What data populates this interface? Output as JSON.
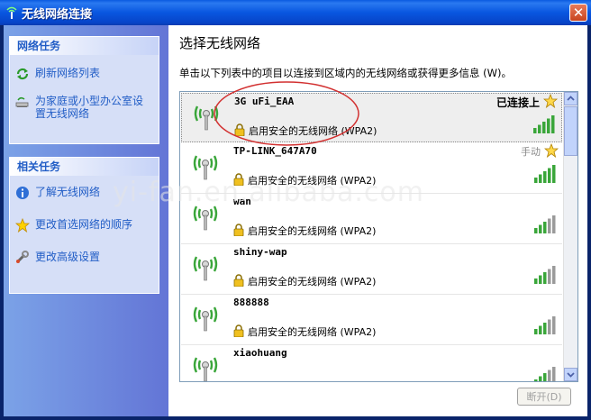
{
  "window": {
    "title": "无线网络连接"
  },
  "sidebar": {
    "network_tasks": {
      "header": "网络任务",
      "items": [
        {
          "label": "刷新网络列表",
          "icon": "refresh-icon"
        },
        {
          "label": "为家庭或小型办公室设置无线网络",
          "icon": "wireless-setup-icon"
        }
      ]
    },
    "related_tasks": {
      "header": "相关任务",
      "items": [
        {
          "label": "了解无线网络",
          "icon": "info-icon"
        },
        {
          "label": "更改首选网络的顺序",
          "icon": "star-icon"
        },
        {
          "label": "更改高级设置",
          "icon": "settings-icon"
        }
      ]
    }
  },
  "main": {
    "title": "选择无线网络",
    "description": "单击以下列表中的项目以连接到区域内的无线网络或获得更多信息 (W)。",
    "networks": [
      {
        "ssid": "3G uFi_EAA",
        "security": "启用安全的无线网络 (WPA2)",
        "status": "已连接上",
        "starred": true,
        "signal": 5
      },
      {
        "ssid": "TP-LINK_647A70",
        "security": "启用安全的无线网络 (WPA2)",
        "status": "手动",
        "starred": true,
        "signal": 5
      },
      {
        "ssid": "wan",
        "security": "启用安全的无线网络 (WPA2)",
        "status": "",
        "starred": false,
        "signal": 3
      },
      {
        "ssid": "shiny-wap",
        "security": "启用安全的无线网络 (WPA2)",
        "status": "",
        "starred": false,
        "signal": 3
      },
      {
        "ssid": "888888",
        "security": "启用安全的无线网络 (WPA2)",
        "status": "",
        "starred": false,
        "signal": 3
      },
      {
        "ssid": "xiaohuang",
        "security": "",
        "status": "",
        "starred": false,
        "signal": 3
      }
    ],
    "connect_button": "断开(D)"
  },
  "watermark": "yi-fan.en.alibaba.com",
  "colors": {
    "titlebar": "#0856e0",
    "sidebar": "#6375d6",
    "link": "#215dc6",
    "signal_on": "#3aa63a",
    "signal_off": "#9a9a9a",
    "annotation": "#d23030"
  }
}
